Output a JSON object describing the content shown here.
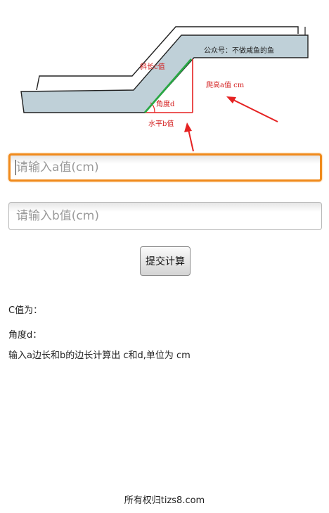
{
  "diagram": {
    "wechat_text": "公众号：不做咸鱼的鱼",
    "label_c": "斜长c值",
    "label_a": "爬高a值 cm",
    "label_angle": "角度d",
    "label_b": "水平b值",
    "colors": {
      "slope_line": "#2aa845",
      "measure_lines": "#e52222",
      "step_fill": "#bfd0d8",
      "label_text": "#d31c1c"
    }
  },
  "form": {
    "input_a_placeholder": "请输入a值(cm)",
    "input_b_placeholder": "请输入b值(cm)",
    "submit_label": "提交计算",
    "focus_color": "#f08a1c"
  },
  "results": {
    "c_label": "C值为：",
    "d_label": "角度d：",
    "hint": "输入a边长和b的边长计算出 c和d,单位为  cm"
  },
  "footer": {
    "copyright": "所有权归tizs8.com"
  }
}
